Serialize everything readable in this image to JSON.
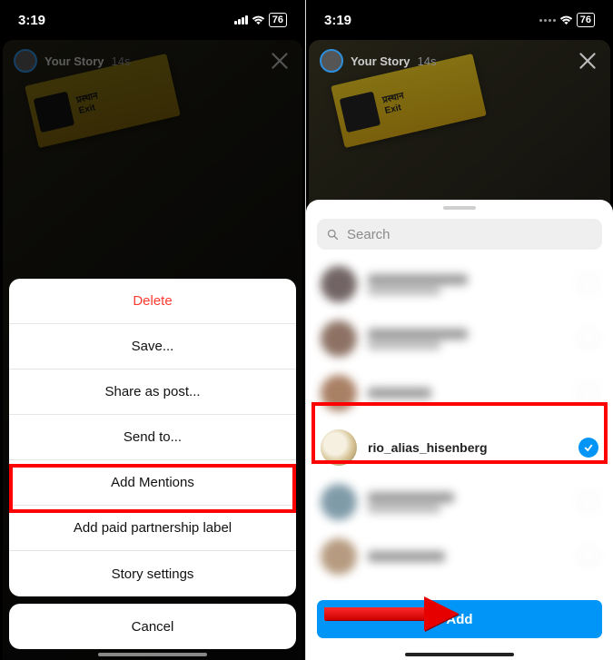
{
  "status": {
    "time": "3:19",
    "battery": "76"
  },
  "story": {
    "title": "Your Story",
    "age": "14s",
    "sign_line1": "प्रस्थान",
    "sign_line2": "Exit"
  },
  "sheet": {
    "items": [
      {
        "label": "Delete",
        "danger": true
      },
      {
        "label": "Save..."
      },
      {
        "label": "Share as post..."
      },
      {
        "label": "Send to..."
      },
      {
        "label": "Add Mentions",
        "highlight": true
      },
      {
        "label": "Add paid partnership label"
      },
      {
        "label": "Story settings"
      }
    ],
    "cancel": "Cancel"
  },
  "mentions": {
    "search_placeholder": "Search",
    "selected_user": "rio_alias_hisenberg",
    "add_label": "Add"
  }
}
